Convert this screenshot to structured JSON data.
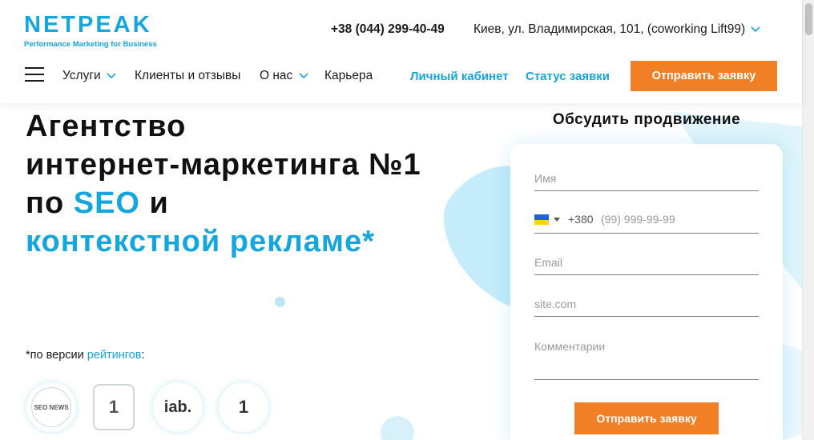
{
  "header": {
    "logo_text": "NETPEAK",
    "logo_tagline": "Performance Marketing for Business",
    "phone": "+38 (044) 299-40-49",
    "address": "Киев, ул. Владимирская, 101, (coworking Lift99)",
    "nav": [
      {
        "label": "Услуги"
      },
      {
        "label": "Клиенты и отзывы"
      },
      {
        "label": "О нас"
      },
      {
        "label": "Карьера"
      }
    ],
    "account_link": "Личный кабинет",
    "status_link": "Статус заявки",
    "cta_label": "Отправить заявку"
  },
  "hero": {
    "line1": "Агентство",
    "line2": "интернет-маркетинга №1",
    "line3_pre": "по ",
    "line3_accent": "SEO",
    "line3_post": " и",
    "line4_accent": "контекстной рекламе*",
    "rating_prefix": "*по версии ",
    "rating_link": "рейтингов",
    "rating_suffix": ":"
  },
  "badges": [
    {
      "text": "SEO NEWS"
    },
    {
      "text": "1"
    },
    {
      "text": "iab."
    },
    {
      "text": "1"
    }
  ],
  "form": {
    "title": "Обсудить продвижение",
    "name_placeholder": "Имя",
    "phone_prefix": "+380",
    "phone_placeholder": "(99) 999-99-99",
    "email_placeholder": "Email",
    "site_placeholder": "site.com",
    "comment_placeholder": "Комментарии",
    "submit_label": "Отправить заявку"
  },
  "colors": {
    "accent": "#14a6dd",
    "cta": "#f07f25"
  }
}
